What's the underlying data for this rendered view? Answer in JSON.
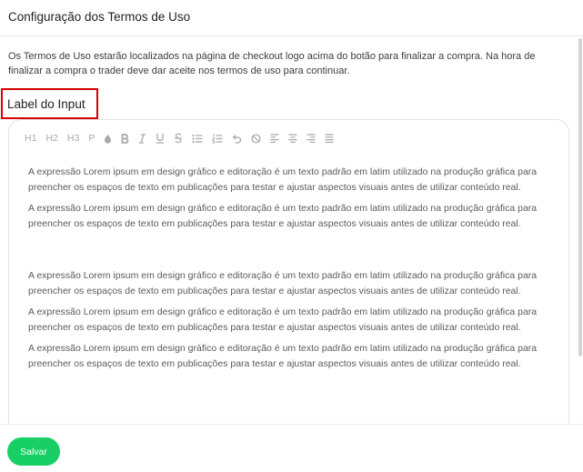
{
  "header": {
    "title": "Configuração dos Termos de Uso"
  },
  "description": "Os Termos de Uso estarão localizados na página de checkout logo acima do botão para finalizar a compra. Na hora de finalizar a compra o trader deve dar aceite nos termos de uso para continuar.",
  "field": {
    "label": "Label do Input"
  },
  "toolbar": {
    "h1": "H1",
    "h2": "H2",
    "h3": "H3",
    "p": "P",
    "icons": [
      "color-drop-icon",
      "bold-icon",
      "italic-icon",
      "underline-icon",
      "strikethrough-icon",
      "bullet-list-icon",
      "ordered-list-icon",
      "undo-icon",
      "clear-format-icon",
      "align-left-icon",
      "align-center-icon",
      "align-right-icon",
      "align-justify-icon"
    ]
  },
  "editor": {
    "paragraphs": [
      "A expressão Lorem ipsum em design gráfico e editoração é um texto padrão em latim utilizado na produção gráfica para preencher os espaços de texto em publicações para testar e ajustar aspectos visuais antes de utilizar conteúdo real.",
      "A expressão Lorem ipsum em design gráfico e editoração é um texto padrão em latim utilizado na produção gráfica para preencher os espaços de texto em publicações para testar e ajustar aspectos visuais antes de utilizar conteúdo real.",
      "A expressão Lorem ipsum em design gráfico e editoração é um texto padrão em latim utilizado na produção gráfica para preencher os espaços de texto em publicações para testar e ajustar aspectos visuais antes de utilizar conteúdo real.",
      "A expressão Lorem ipsum em design gráfico e editoração é um texto padrão em latim utilizado na produção gráfica para preencher os espaços de texto em publicações para testar e ajustar aspectos visuais antes de utilizar conteúdo real.",
      "A expressão Lorem ipsum em design gráfico e editoração é um texto padrão em latim utilizado na produção gráfica para preencher os espaços de texto em publicações para testar e ajustar aspectos visuais antes de utilizar conteúdo real."
    ]
  },
  "footer": {
    "save_label": "Salvar"
  },
  "colors": {
    "accent": "#17cf64",
    "highlight_border": "#d90000"
  }
}
